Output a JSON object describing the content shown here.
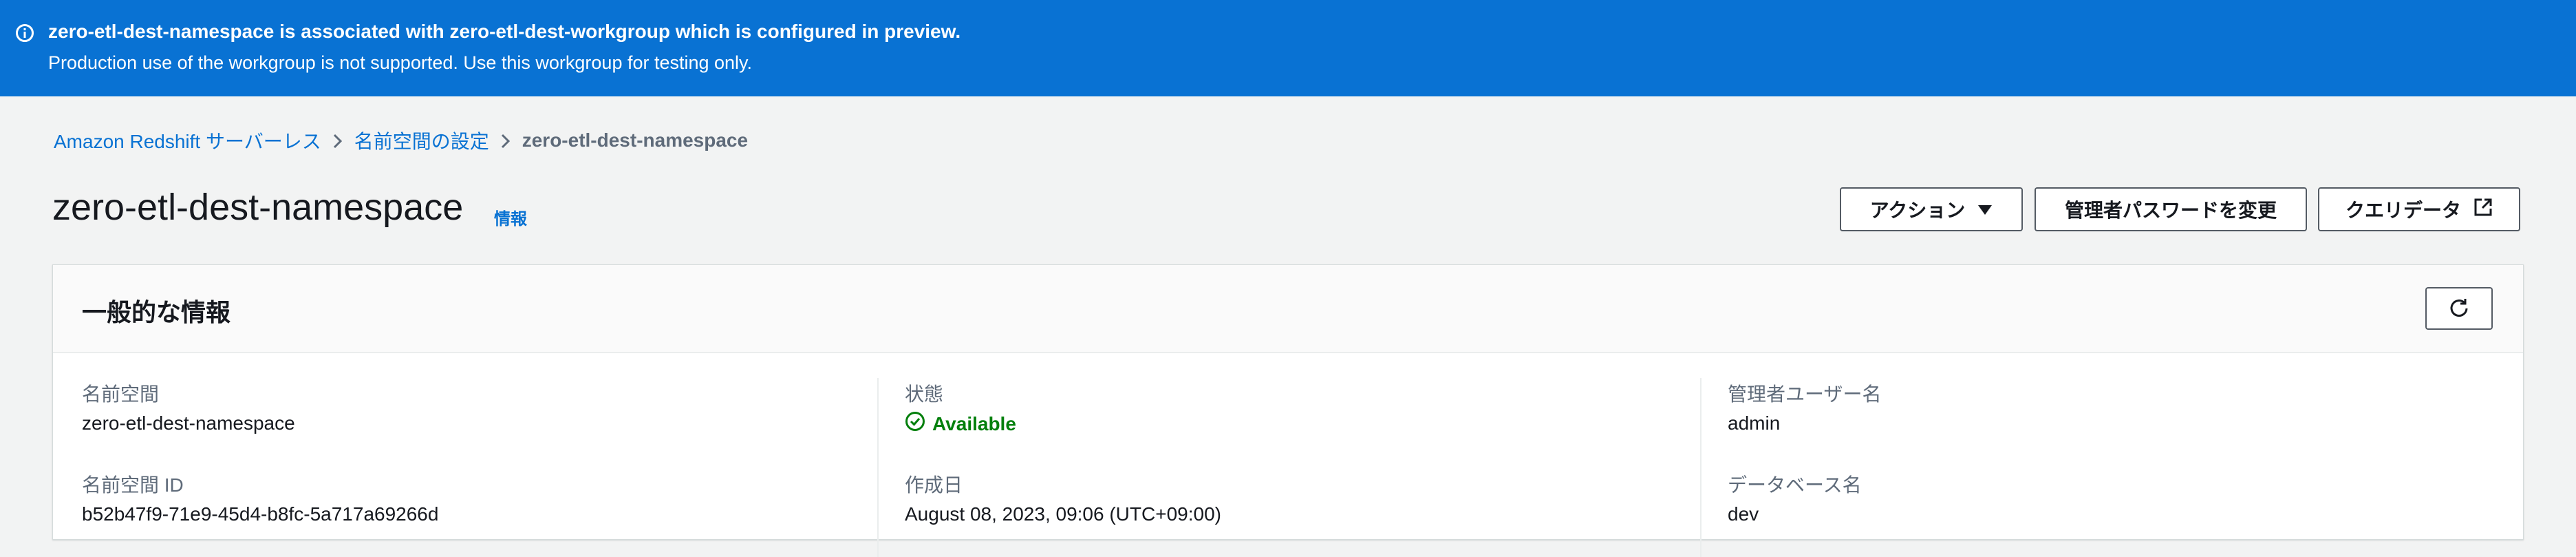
{
  "banner": {
    "title": "zero-etl-dest-namespace is associated with zero-etl-dest-workgroup which is configured in preview.",
    "body": "Production use of the workgroup is not supported. Use this workgroup for testing only.",
    "icon": "info-icon"
  },
  "breadcrumb": {
    "items": [
      "Amazon Redshift サーバーレス",
      "名前空間の設定"
    ],
    "current": "zero-etl-dest-namespace"
  },
  "header": {
    "title": "zero-etl-dest-namespace",
    "info_link": "情報",
    "actions_label": "アクション",
    "change_password_label": "管理者パスワードを変更",
    "query_editor_label": "クエリデータ"
  },
  "general_info": {
    "title": "一般的な情報",
    "namespace_label": "名前空間",
    "namespace_value": "zero-etl-dest-namespace",
    "namespace_id_label": "名前空間 ID",
    "namespace_id_value": "b52b47f9-71e9-45d4-b8fc-5a717a69266d",
    "status_label": "状態",
    "status_value": "Available",
    "created_label": "作成日",
    "created_value": "August 08, 2023, 09:06 (UTC+09:00)",
    "admin_user_label": "管理者ユーザー名",
    "admin_user_value": "admin",
    "database_label": "データベース名",
    "database_value": "dev"
  },
  "colors": {
    "banner_bg": "#0972d3",
    "link": "#0972d3",
    "success": "#037f0c",
    "page_bg": "#f2f3f3"
  }
}
